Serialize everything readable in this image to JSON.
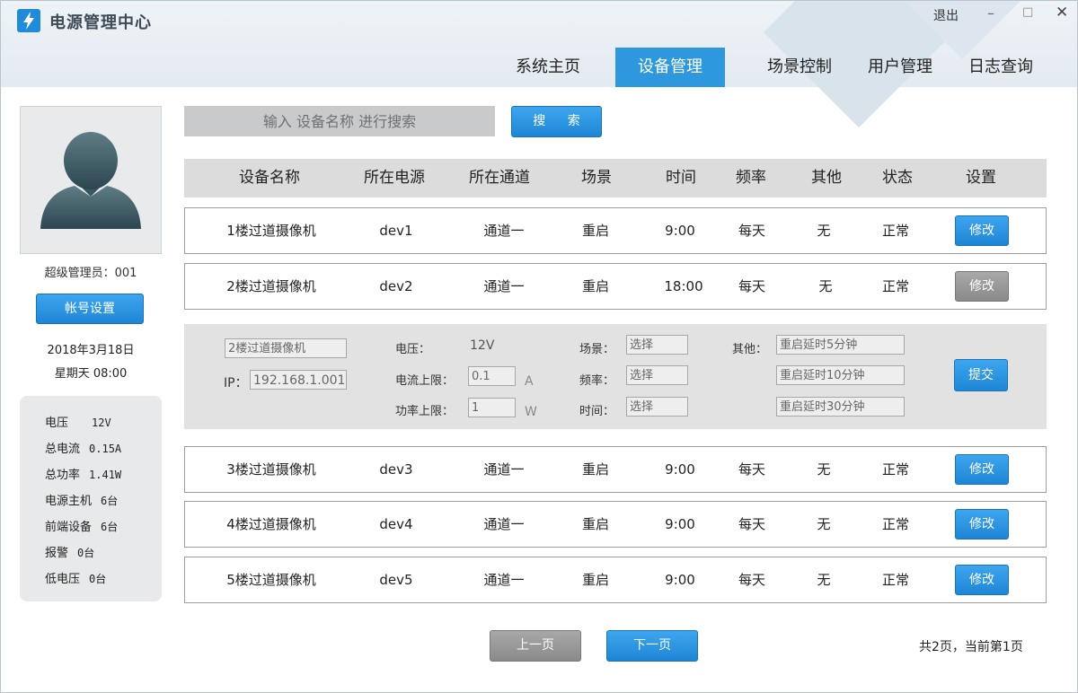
{
  "app": {
    "title": "电源管理中心"
  },
  "window_controls": {
    "exit": "退出",
    "minimize": "–",
    "maximize": "□",
    "close": "✕"
  },
  "nav": [
    {
      "label": "系统主页",
      "active": false
    },
    {
      "label": "设备管理",
      "active": true
    },
    {
      "label": "场景控制",
      "active": false
    },
    {
      "label": "用户管理",
      "active": false
    },
    {
      "label": "日志查询",
      "active": false
    }
  ],
  "sidebar": {
    "user_label": "超级管理员：001",
    "account_button": "帐号设置",
    "date": "2018年3月18日",
    "weekday_time": "星期天 08:00",
    "stats": [
      {
        "label": "电压",
        "value": "12V"
      },
      {
        "label": "总电流",
        "value": "0.15A"
      },
      {
        "label": "总功率",
        "value": "1.41W"
      },
      {
        "label": "电源主机",
        "value": "6台"
      },
      {
        "label": "前端设备",
        "value": "6台"
      },
      {
        "label": "报警",
        "value": "0台"
      },
      {
        "label": "低电压",
        "value": "0台"
      }
    ]
  },
  "search": {
    "placeholder": "输入 设备名称 进行搜索",
    "button": "搜 索"
  },
  "table": {
    "headers": [
      "设备名称",
      "所在电源",
      "所在通道",
      "场景",
      "时间",
      "频率",
      "其他",
      "状态",
      "设置"
    ],
    "rows": [
      {
        "name": "1楼过道摄像机",
        "power": "dev1",
        "channel": "通道一",
        "scene": "重启",
        "time": "9:00",
        "freq": "每天",
        "other": "无",
        "status": "正常",
        "action": "修改",
        "editing": false
      },
      {
        "name": "2楼过道摄像机",
        "power": "dev2",
        "channel": "通道一",
        "scene": "重启",
        "time": "18:00",
        "freq": "每天",
        "other": "无",
        "status": "正常",
        "action": "修改",
        "editing": true
      },
      {
        "name": "3楼过道摄像机",
        "power": "dev3",
        "channel": "通道一",
        "scene": "重启",
        "time": "9:00",
        "freq": "每天",
        "other": "无",
        "status": "正常",
        "action": "修改",
        "editing": false
      },
      {
        "name": "4楼过道摄像机",
        "power": "dev4",
        "channel": "通道一",
        "scene": "重启",
        "time": "9:00",
        "freq": "每天",
        "other": "无",
        "status": "正常",
        "action": "修改",
        "editing": false
      },
      {
        "name": "5楼过道摄像机",
        "power": "dev5",
        "channel": "通道一",
        "scene": "重启",
        "time": "9:00",
        "freq": "每天",
        "other": "无",
        "status": "正常",
        "action": "修改",
        "editing": false
      }
    ]
  },
  "edit_panel": {
    "name_value": "2楼过道摄像机",
    "ip_label": "IP：",
    "ip_value": "192.168.1.001",
    "voltage_label": "电压：",
    "voltage_value": "12V",
    "current_label": "电流上限：",
    "current_value": "0.1",
    "current_unit": "A",
    "power_label": "功率上限：",
    "power_value": "1",
    "power_unit": "W",
    "scene_label": "场景：",
    "scene_value": "选择",
    "freq_label": "频率：",
    "freq_value": "选择",
    "time_label": "时间：",
    "time_value": "选择",
    "other_label": "其他：",
    "other_options": [
      "重启延时5分钟",
      "重启延时10分钟",
      "重启延时30分钟"
    ],
    "submit_button": "提交"
  },
  "pagination": {
    "prev": "上一页",
    "next": "下一页",
    "info": "共2页，当前第1页"
  },
  "colors": {
    "accent": "#2e98df",
    "button_blue": "#1e86d6",
    "button_gray": "#8a8a8a",
    "header_bg": "#e3eaf0"
  },
  "icons": {
    "logo": "lightning-bolt-icon",
    "avatar": "user-silhouette-icon"
  }
}
